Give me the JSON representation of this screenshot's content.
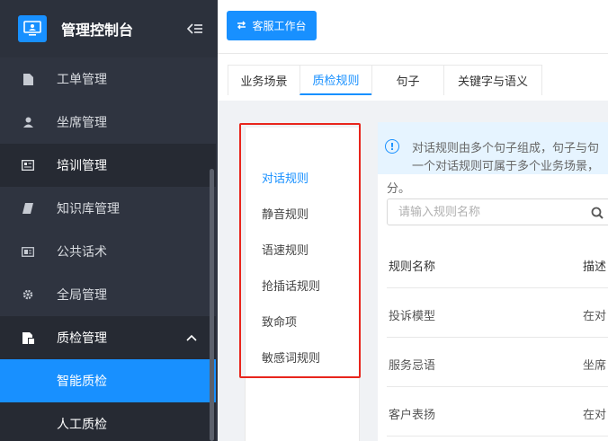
{
  "sidebar": {
    "brand": "管理控制台",
    "items": [
      {
        "label": "工单管理",
        "icon": "document-icon"
      },
      {
        "label": "坐席管理",
        "icon": "user-icon"
      },
      {
        "label": "培训管理",
        "icon": "id-card-icon"
      },
      {
        "label": "知识库管理",
        "icon": "book-icon"
      },
      {
        "label": "公共话术",
        "icon": "newspaper-icon"
      },
      {
        "label": "全局管理",
        "icon": "gear-icon"
      },
      {
        "label": "质检管理",
        "icon": "quality-icon"
      },
      {
        "label": "智能质检",
        "icon": ""
      },
      {
        "label": "人工质检",
        "icon": ""
      }
    ]
  },
  "topbar": {
    "workspace_button": "客服工作台"
  },
  "tabs": [
    {
      "label": "业务场景"
    },
    {
      "label": "质检规则"
    },
    {
      "label": "句子"
    },
    {
      "label": "关键字与语义"
    }
  ],
  "rules": [
    {
      "label": "对话规则"
    },
    {
      "label": "静音规则"
    },
    {
      "label": "语速规则"
    },
    {
      "label": "抢插话规则"
    },
    {
      "label": "致命项"
    },
    {
      "label": "敏感词规则"
    }
  ],
  "info": {
    "line1": "对话规则由多个句子组成，句子与句",
    "line2": "一个对话规则可属于多个业务场景，",
    "line3": "分。"
  },
  "search": {
    "placeholder": "请输入规则名称"
  },
  "table": {
    "columns": [
      "规则名称",
      "描述"
    ],
    "rows": [
      {
        "name": "投诉模型",
        "desc": "在对"
      },
      {
        "name": "服务忌语",
        "desc": "坐席"
      },
      {
        "name": "客户表扬",
        "desc": "在对"
      }
    ]
  },
  "colors": {
    "sidebar_bg": "#2f3440",
    "accent": "#1890ff",
    "highlight_box": "#e8251c"
  }
}
